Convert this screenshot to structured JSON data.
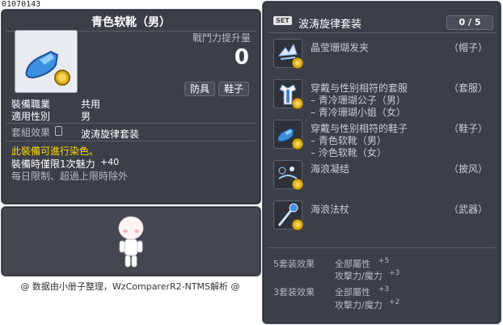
{
  "item_id": "01070143",
  "item": {
    "name": "青色软靴（男）",
    "power_label": "戰鬥力提升量",
    "power_value": "0",
    "tags": [
      "防具",
      "鞋子"
    ],
    "job_label": "裝備職業",
    "job_value": "共用",
    "gender_label": "適用性別",
    "gender_value": "男",
    "set_label": "套組效果",
    "set_value": "波涛旋律套装",
    "dye_note": "此裝備可進行染色。",
    "charm_label": "裝備時僅限1次魅力",
    "charm_value": "+40",
    "limit_note": "每日限制、超過上限時除外"
  },
  "footer": "@ 数据由小册子整理，WzComparerR2-NTMS解析 @",
  "set_panel": {
    "badge": "SET",
    "title": "波涛旋律套装",
    "count": "0 / 5",
    "items": [
      {
        "name": "晶莹珊瑚发夹",
        "slot": "（帽子）",
        "subs": []
      },
      {
        "name": "穿戴与性别相符的套服",
        "slot": "（套服）",
        "subs": [
          "– 青冷珊瑚公子（男）",
          "– 青冷珊瑚小姐（女）"
        ]
      },
      {
        "name": "穿戴与性别相符的鞋子",
        "slot": "（鞋子）",
        "subs": [
          "– 青色软靴（男）",
          "– 泠色软靴（女）"
        ]
      },
      {
        "name": "海浪凝结",
        "slot": "（披风）",
        "subs": []
      },
      {
        "name": "海浪法杖",
        "slot": "（武器）",
        "subs": []
      }
    ],
    "effects": [
      {
        "label": "5套装效果",
        "lines": [
          {
            "name": "全部屬性",
            "val": "+5"
          },
          {
            "name": "攻擊力/魔力",
            "val": "+3"
          }
        ]
      },
      {
        "label": "3套装效果",
        "lines": [
          {
            "name": "全部屬性",
            "val": "+3"
          },
          {
            "name": "攻擊力/魔力",
            "val": "+2"
          }
        ]
      }
    ]
  }
}
